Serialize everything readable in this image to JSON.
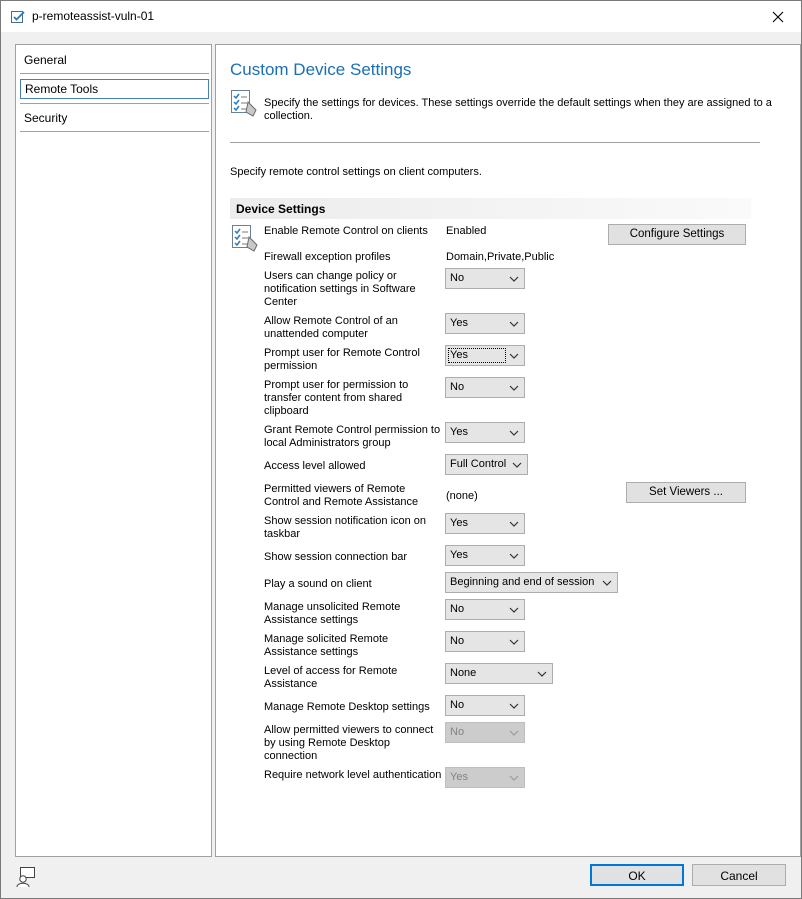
{
  "window": {
    "title": "p-remoteassist-vuln-01",
    "close_label": "✕"
  },
  "nav": {
    "items": [
      {
        "label": "General",
        "selected": false
      },
      {
        "label": "Remote Tools",
        "selected": true
      },
      {
        "label": "Security",
        "selected": false
      }
    ]
  },
  "main": {
    "title": "Custom Device Settings",
    "intro": "Specify the settings for devices. These settings override the default settings when they are assigned to a collection.",
    "description": "Specify remote control settings on client computers.",
    "section_title": "Device Settings"
  },
  "settings": {
    "enable_remote_control": {
      "label": "Enable Remote Control on clients",
      "value": "Enabled",
      "button": "Configure Settings"
    },
    "firewall_profiles": {
      "label": "Firewall exception profiles",
      "value": "Domain,Private,Public"
    },
    "users_change_policy": {
      "label": "Users can change policy or notification settings in Software Center",
      "value": "No"
    },
    "unattended": {
      "label": "Allow Remote Control of an unattended computer",
      "value": "Yes"
    },
    "prompt_permission": {
      "label": "Prompt user for Remote Control permission",
      "value": "Yes"
    },
    "prompt_clipboard": {
      "label": "Prompt user for permission to transfer content from shared clipboard",
      "value": "No"
    },
    "grant_admins": {
      "label": "Grant Remote Control permission to local Administrators group",
      "value": "Yes"
    },
    "access_level": {
      "label": "Access level allowed",
      "value": "Full Control"
    },
    "permitted_viewers": {
      "label": "Permitted viewers of Remote Control and Remote Assistance",
      "value": "(none)",
      "button": "Set Viewers ..."
    },
    "session_icon": {
      "label": "Show session notification icon on taskbar",
      "value": "Yes"
    },
    "connection_bar": {
      "label": "Show session connection bar",
      "value": "Yes"
    },
    "play_sound": {
      "label": "Play a sound on client",
      "value": "Beginning and end of session"
    },
    "unsolicited_ra": {
      "label": "Manage unsolicited Remote Assistance settings",
      "value": "No"
    },
    "solicited_ra": {
      "label": "Manage solicited Remote Assistance settings",
      "value": "No"
    },
    "ra_access_level": {
      "label": "Level of access for Remote Assistance",
      "value": "None"
    },
    "rdp_settings": {
      "label": "Manage Remote Desktop settings",
      "value": "No"
    },
    "rdp_viewers": {
      "label": "Allow permitted viewers to connect by using Remote Desktop connection",
      "value": "No"
    },
    "nla": {
      "label": "Require network level authentication",
      "value": "Yes"
    }
  },
  "footer": {
    "ok_label": "OK",
    "cancel_label": "Cancel"
  },
  "colors": {
    "title_blue": "#1b6fb5",
    "focus_blue": "#0078d7"
  }
}
